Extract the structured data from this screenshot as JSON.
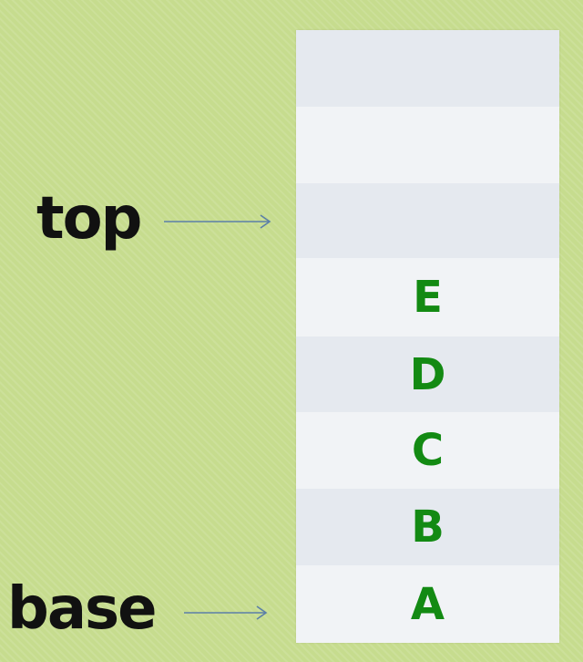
{
  "pointers": {
    "top_label": "top",
    "base_label": "base"
  },
  "stack": {
    "cells": [
      "",
      "",
      "",
      "E",
      "D",
      "C",
      "B",
      "A"
    ]
  },
  "colors": {
    "background": "#c6dc8e",
    "cell_dark": "#e5e9ef",
    "cell_light": "#f1f3f6",
    "cell_text": "#138a13",
    "arrow": "#5b7fa8",
    "label_text": "#111111"
  }
}
